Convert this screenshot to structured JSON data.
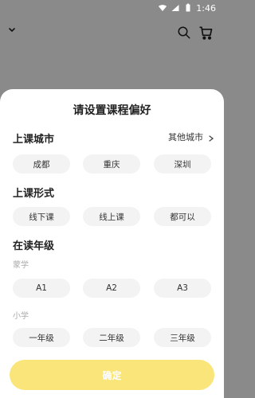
{
  "status": {
    "time": "1:46"
  },
  "sheet": {
    "title": "请设置课程偏好",
    "sections": {
      "city_title": "上课城市",
      "other_city": "其他城市",
      "format_title": "上课形式",
      "grade_title": "在读年级",
      "grade_group_1": "蒙学",
      "grade_group_2": "小学"
    },
    "cities": [
      "成都",
      "重庆",
      "深圳"
    ],
    "formats": [
      "线下课",
      "线上课",
      "都可以"
    ],
    "grades_1": [
      "A1",
      "A2",
      "A3"
    ],
    "grades_2": [
      "一年级",
      "二年级",
      "三年级"
    ],
    "confirm": "确定"
  },
  "colors": {
    "overlay": "#8a8a8a",
    "confirm_bg": "#fae57a",
    "chip_bg": "#f3f3f3"
  }
}
